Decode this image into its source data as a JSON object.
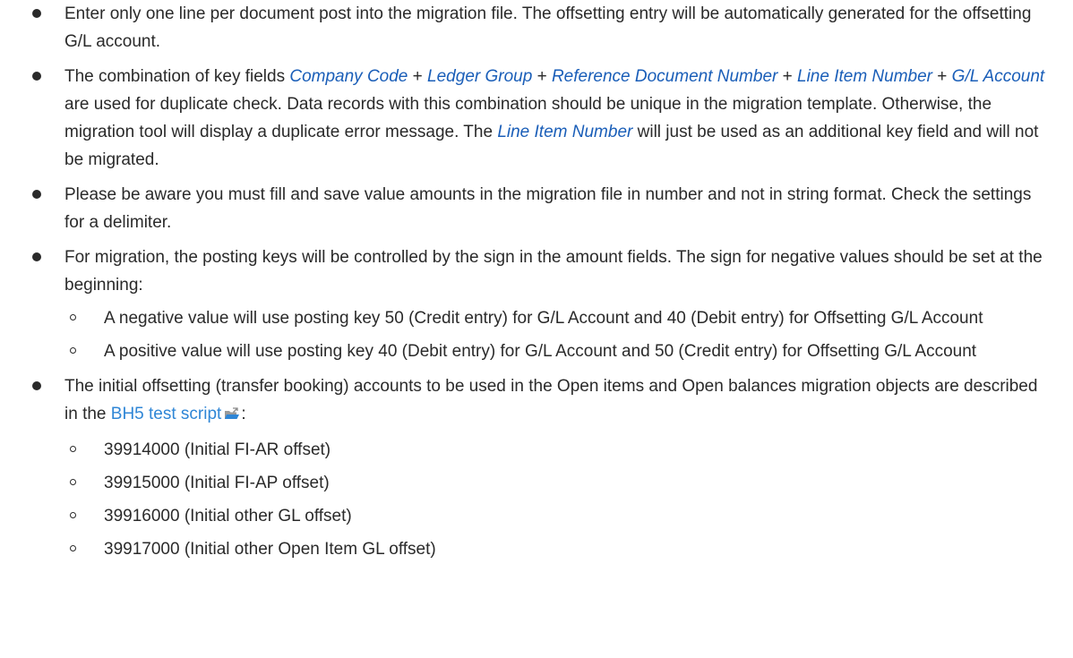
{
  "bullets": [
    {
      "text": "Enter only one line per document post into the migration file. The offsetting entry will be automatically generated for the offsetting G/L account."
    },
    {
      "t0": "The combination of key fields ",
      "f1": "Company Code",
      "t1": " + ",
      "f2": "Ledger Group",
      "t2": " + ",
      "f3": "Reference Document Number",
      "t3": " + ",
      "f4": "Line Item Number",
      "t4": " + ",
      "f5": "G/L Account",
      "t5": " are used for duplicate check. Data records with this combination should be unique in the migration template. Otherwise, the migration tool will display a duplicate error message. The ",
      "f6": "Line Item Number",
      "t6": " will just be used as an additional key field and will not be migrated."
    },
    {
      "text": "Please be aware you must fill and save value amounts in the migration file in number and not in string format. Check the settings for a delimiter."
    },
    {
      "text": "For migration, the posting keys will be controlled by the sign in the amount fields. The sign for negative values should be set at the beginning:",
      "sub_items": [
        "A negative value will use posting key 50 (Credit entry) for G/L Account and 40 (Debit entry) for Offsetting G/L Account",
        "A positive value will use posting key 40 (Debit entry) for G/L Account and 50 (Credit entry) for Offsetting G/L Account"
      ]
    },
    {
      "text_before": "The initial offsetting (transfer booking) accounts to be used in the Open items and Open balances migration objects are described in the ",
      "link_text": "BH5 test script",
      "link_icon": "external-document-icon",
      "text_after": ":",
      "sub_items": [
        "39914000 (Initial FI-AR offset)",
        "39915000 (Initial FI-AP offset)",
        "39916000 (Initial other GL offset)",
        "39917000 (Initial other Open Item GL offset)"
      ]
    }
  ],
  "colors": {
    "text": "#2a2a2a",
    "field_reference": "#1a5eb8",
    "link": "#2f86d6"
  }
}
